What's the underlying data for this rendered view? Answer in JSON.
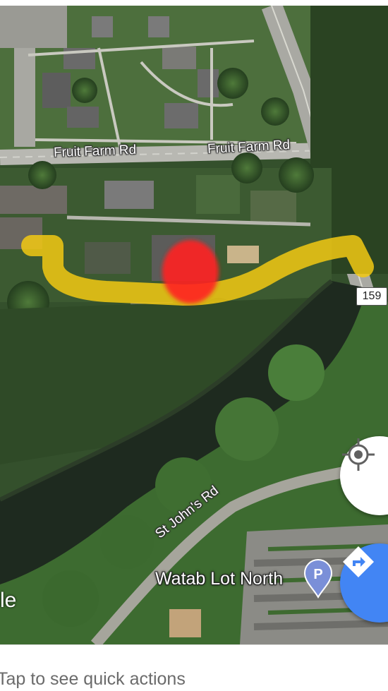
{
  "map": {
    "roads": {
      "fruit_farm_rd_left": "Fruit Farm Rd",
      "fruit_farm_rd_right": "Fruit Farm Rd",
      "st_johns_rd": "St John's Rd"
    },
    "highway_shield": "159",
    "places": {
      "parking_lot": "Watab Lot North"
    },
    "logo_fragment": "le",
    "route_color": "#f2c913",
    "marker_color": "#ff2222",
    "parking_icon": "parking-icon"
  },
  "buttons": {
    "my_location_icon": "crosshair-icon",
    "directions_icon": "directions-icon",
    "directions_color": "#4285f4"
  },
  "bottom_sheet": {
    "hint": "Tap to see quick actions"
  }
}
